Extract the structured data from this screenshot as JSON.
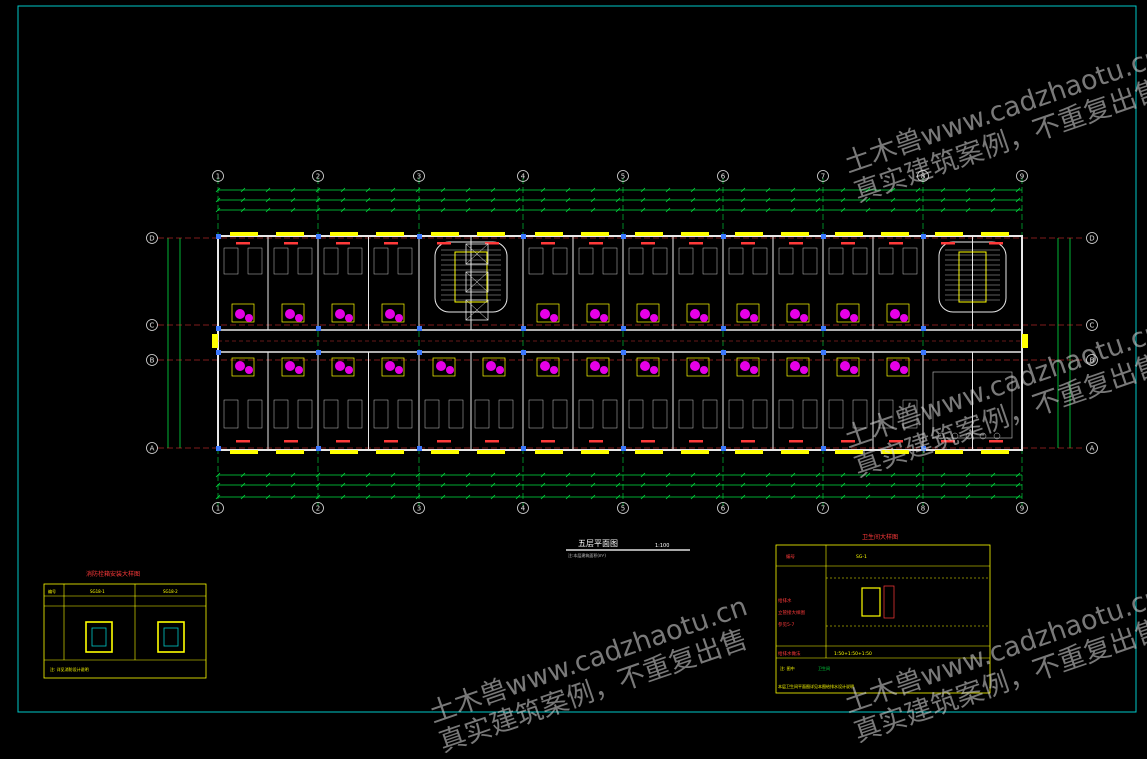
{
  "drawing": {
    "main_title": "五层平面图",
    "main_scale": "1:100",
    "main_note": "注:本层建筑面积(m²)",
    "axis_numbers": [
      "1",
      "2",
      "3",
      "4",
      "5",
      "6",
      "7",
      "8",
      "9"
    ],
    "axis_letters": [
      "D",
      "C",
      "B",
      "A"
    ],
    "left_table": {
      "title": "消防栓箱安装大样图",
      "headers": [
        "编号",
        "SG18-1",
        "SG18-2"
      ],
      "footer": "注: 详见消防设计说明"
    },
    "right_table": {
      "title": "卫生间大样图",
      "row1_label": "编号",
      "row1_value": "SG-1",
      "row2_lines": [
        "给排水",
        "立管接大样图",
        "参见5-7"
      ],
      "row3_label": "给排水做法",
      "row3_value": "1:50+1:50+1:50",
      "footer1": "注: 图中",
      "footer2": "卫生间",
      "footer3": "本层卫生间平面图详见本图给排水设计说明"
    },
    "colors": {
      "background": "#000000",
      "border": "#00c8c8",
      "axis": "#00e040",
      "wall": "#e8e8e8",
      "window": "#ffff00",
      "fixture": "#ff00ff",
      "dimension": "#00e040",
      "column": "#3a78ff",
      "label": "#ff3a3a"
    }
  },
  "watermarks": [
    {
      "line1": "土木兽www.cadzhaotu.cn",
      "line2": "真实建筑案例，不重复出售"
    },
    {
      "line1": "土木兽www.cadzhaotu.cn",
      "line2": "真实建筑案例，不重复出售"
    },
    {
      "line1": "土木兽www.cadzhaotu.cn",
      "line2": "真实建筑案例，不重复出售"
    },
    {
      "line1": "土木兽www.cadzhaotu.cn",
      "line2": "真实建筑案例，不重复出售"
    }
  ]
}
